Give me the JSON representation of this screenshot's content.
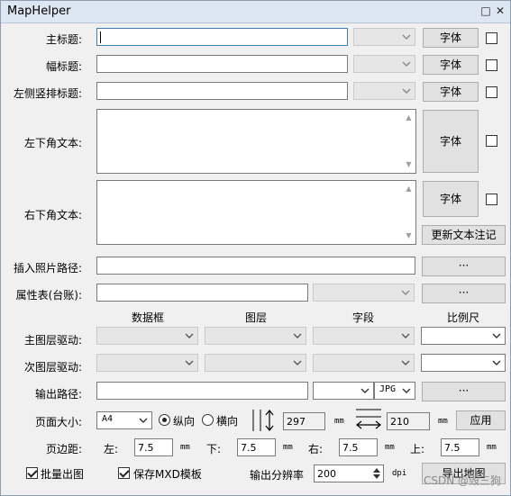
{
  "window": {
    "title": "MapHelper",
    "restore_glyph": "□",
    "close_glyph": "✕"
  },
  "font_button": "字体",
  "rows": [
    {
      "label": "主标题:",
      "value": ""
    },
    {
      "label": "幅标题:",
      "value": ""
    },
    {
      "label": "左侧竖排标题:",
      "value": ""
    }
  ],
  "text_areas": [
    {
      "label": "左下角文本:"
    },
    {
      "label": "右下角文本:"
    }
  ],
  "update_button": "更新文本注记",
  "photo_path": {
    "label": "插入照片路径:",
    "value": "",
    "button": "···"
  },
  "attr_table": {
    "label": "属性表(台账):",
    "value": "",
    "button": "···"
  },
  "columns": [
    "数据框",
    "图层",
    "字段",
    "比例尺"
  ],
  "main_layer": {
    "label": "主图层驱动:"
  },
  "sub_layer": {
    "label": "次图层驱动:"
  },
  "output": {
    "label": "输出路径:",
    "value": "",
    "format": "JPG",
    "button": "···"
  },
  "page": {
    "label": "页面大小:",
    "size": "A4",
    "portrait": "纵向",
    "landscape": "横向",
    "height": "297",
    "width": "210",
    "unit": "mm",
    "apply": "应用",
    "orientation_selected": "portrait"
  },
  "margins": {
    "label": "页边距:",
    "left_label": "左:",
    "left": "7.5",
    "bottom_label": "下:",
    "bottom": "7.5",
    "right_label": "右:",
    "right": "7.5",
    "top_label": "上:",
    "top": "7.5",
    "unit": "mm"
  },
  "bottom": {
    "batch": "批量出图",
    "batch_checked": true,
    "save_mxd": "保存MXD模板",
    "save_mxd_checked": true,
    "dpi_label": "输出分辨率",
    "dpi": "200",
    "dpi_unit": "dpi",
    "export": "导出地图"
  },
  "watermark": "CSDN @毁三狗"
}
